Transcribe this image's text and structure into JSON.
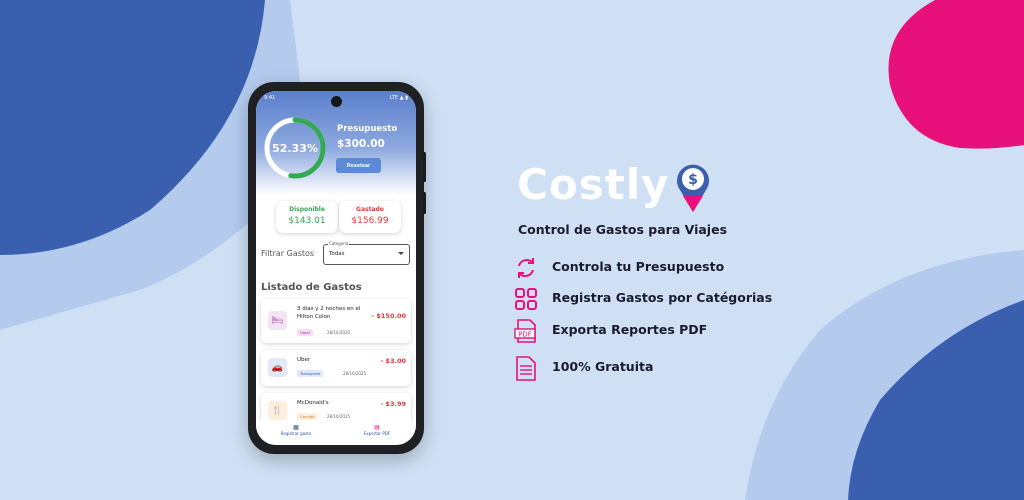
{
  "colors": {
    "background": "#cfe0f5",
    "blue_shape": "#3a5fae",
    "light_shape": "#b4cbee",
    "pink_accent": "#e8107a",
    "brand_text": "#ffffff",
    "available_green": "#34a853",
    "spent_red": "#e03a3a"
  },
  "phone": {
    "status_time": "9:41",
    "status_icons": "LTE ▲ ▮",
    "progress": {
      "percent_label": "52.33%",
      "fraction": 0.5233
    },
    "budget": {
      "label": "Presupuesto",
      "value": "$300.00",
      "reset_label": "Resetear"
    },
    "available": {
      "label": "Disponible",
      "value": "$143.01"
    },
    "spent": {
      "label": "Gastado",
      "value": "$156.99"
    },
    "filter": {
      "label": "Filtrar Gastos",
      "caption": "Categoría",
      "value": "Todas"
    },
    "list_title": "Listado de Gastos",
    "expenses": [
      {
        "name": "3 días y 2 noches en el Hilton Colon",
        "amount": "- $150.00",
        "category": "Hotel",
        "date": "28/10/2025",
        "icon": "bed-icon"
      },
      {
        "name": "Uber",
        "amount": "- $3.00",
        "category": "Transporte",
        "date": "28/10/2025",
        "icon": "car-icon"
      },
      {
        "name": "McDonald's",
        "amount": "- $3.99",
        "category": "Comida",
        "date": "28/10/2025",
        "icon": "fork-knife-icon"
      }
    ],
    "nav": {
      "register_label": "Registrar gasto",
      "export_label": "Exportar PDF"
    }
  },
  "brand": {
    "name": "Costly",
    "tagline": "Control de Gastos para Viajes",
    "features": [
      {
        "text": "Controla tu Presupuesto",
        "icon": "refresh-icon"
      },
      {
        "text": "Registra Gastos por Catégorias",
        "icon": "grid-icon"
      },
      {
        "text": "Exporta Reportes PDF",
        "icon": "pdf-icon"
      },
      {
        "text": "100% Gratuita",
        "icon": "document-icon"
      }
    ]
  }
}
